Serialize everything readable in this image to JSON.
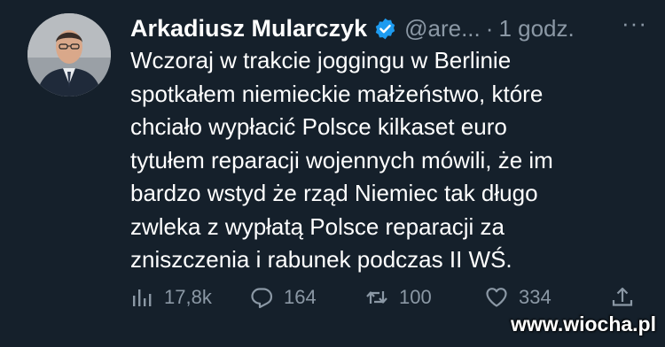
{
  "tweet": {
    "author_name": "Arkadiusz Mularczyk",
    "handle": "@are...",
    "separator": "·",
    "time": "1 godz.",
    "more_label": "···",
    "text": "Wczoraj w trakcie joggingu w Berlinie\nspotkałem niemieckie małżeństwo, które\nchciało wypłacić  Polsce kilkaset euro\ntytułem reparacji wojennych mówili, że im\nbardzo wstyd że rząd Niemiec tak długo\nzwleka z wypłatą Polsce reparacji za\nzniszczenia i rabunek podczas II WŚ.",
    "stats": {
      "views": "17,8k",
      "replies": "164",
      "retweets": "100",
      "likes": "334"
    }
  },
  "watermark": "www.wiocha.pl",
  "colors": {
    "background": "#15202b",
    "secondary_text": "#8b98a5",
    "verified_badge": "#1d9bf0"
  },
  "icons": [
    "views-icon",
    "reply-icon",
    "retweet-icon",
    "like-icon",
    "share-icon",
    "verified-icon",
    "more-icon"
  ]
}
